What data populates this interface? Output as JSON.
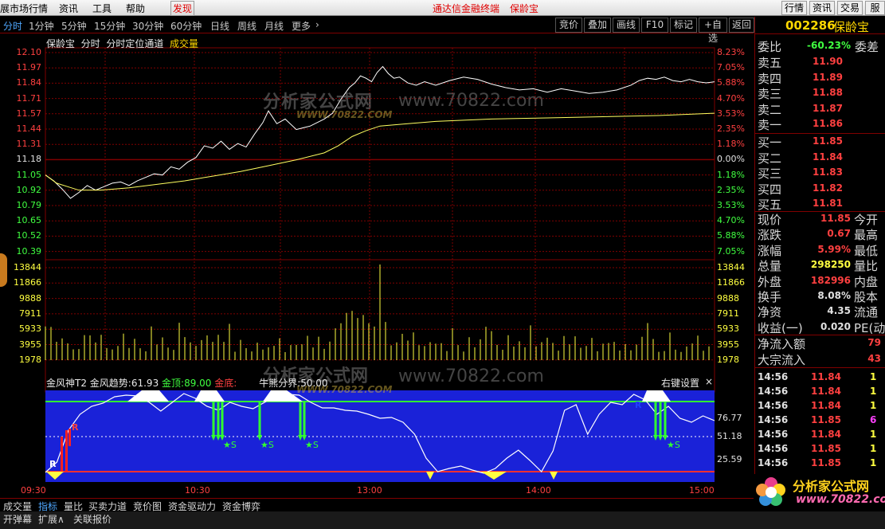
{
  "menubar": {
    "items": [
      "展市场行情",
      "资讯",
      "工具",
      "帮助"
    ],
    "discover": "发现",
    "center_app": "通达信金融终端",
    "center_stock": "保龄宝",
    "right_buttons": [
      "行情",
      "资讯",
      "交易",
      "服"
    ]
  },
  "toolbar": {
    "periods": [
      "分时",
      "1分钟",
      "5分钟",
      "15分钟",
      "30分钟",
      "60分钟",
      "日线",
      "周线",
      "月线",
      "更多"
    ],
    "more_arrow": "›",
    "buttons": [
      "竞价",
      "叠加",
      "画线",
      "F10",
      "标记",
      "+自选",
      "返回"
    ]
  },
  "chart": {
    "title_parts": [
      "保龄宝",
      "分时",
      "分时定位通道"
    ],
    "title_volume": "成交量",
    "price_ticks": [
      "12.10",
      "11.97",
      "11.84",
      "11.71",
      "11.57",
      "11.44",
      "11.31",
      "11.18",
      "11.05",
      "10.92",
      "10.79",
      "10.65",
      "10.52",
      "10.39"
    ],
    "pct_ticks": [
      "8.23%",
      "7.05%",
      "5.88%",
      "4.70%",
      "3.53%",
      "2.35%",
      "1.18%",
      "0.00%",
      "1.18%",
      "2.35%",
      "3.53%",
      "4.70%",
      "5.88%",
      "7.05%"
    ],
    "volume_ticks": [
      "13844",
      "11866",
      "9888",
      "7911",
      "5933",
      "3955",
      "1978"
    ],
    "indicator": {
      "name": "金风神T2",
      "trend_label": "金风趋势:",
      "trend_value": "61.93",
      "top_label": "金顶:",
      "top_value": "89.00",
      "bottom_label": "金底:",
      "bull_label": "牛熊分界:",
      "bull_value": "50.00",
      "settings": "右键设置",
      "close": "×",
      "y_ticks": [
        "76.77",
        "51.18",
        "25.59"
      ],
      "marks": [
        "R",
        "R",
        "R",
        "★S",
        "★S",
        "★S",
        "★S"
      ]
    },
    "time_ticks": [
      "09:30",
      "10:30",
      "13:00",
      "14:00",
      "15:00"
    ],
    "watermark_cn": "分析家公式网",
    "watermark_url": "www.70822.com",
    "watermark_url_small": "WWW.70822.COM"
  },
  "quote": {
    "code": "002286",
    "name": "保龄宝",
    "webi_label": "委比",
    "webi_value": "-60.23%",
    "weicha_label": "委差",
    "sells": [
      {
        "label": "卖五",
        "price": "11.90"
      },
      {
        "label": "卖四",
        "price": "11.89"
      },
      {
        "label": "卖三",
        "price": "11.88"
      },
      {
        "label": "卖二",
        "price": "11.87"
      },
      {
        "label": "卖一",
        "price": "11.86"
      }
    ],
    "buys": [
      {
        "label": "买一",
        "price": "11.85"
      },
      {
        "label": "买二",
        "price": "11.84"
      },
      {
        "label": "买三",
        "price": "11.83"
      },
      {
        "label": "买四",
        "price": "11.82"
      },
      {
        "label": "买五",
        "price": "11.81"
      }
    ],
    "stats": [
      {
        "label": "现价",
        "value": "11.85",
        "label2": "今开",
        "color": "#ff4040"
      },
      {
        "label": "涨跌",
        "value": "0.67",
        "label2": "最高",
        "color": "#ff4040"
      },
      {
        "label": "涨幅",
        "value": "5.99%",
        "label2": "最低",
        "color": "#ff4040"
      },
      {
        "label": "总量",
        "value": "298250",
        "label2": "量比",
        "color": "#ffff40"
      },
      {
        "label": "外盘",
        "value": "182996",
        "label2": "内盘",
        "color": "#ff4040"
      },
      {
        "label": "换手",
        "value": "8.08%",
        "label2": "股本",
        "color": "#e0e0e0"
      },
      {
        "label": "净资",
        "value": "4.35",
        "label2": "流通",
        "color": "#e0e0e0"
      },
      {
        "label": "收益(一)",
        "value": "0.020",
        "label2": "PE(动",
        "color": "#e0e0e0"
      }
    ],
    "netflow_label": "净流入额",
    "netflow_value": "79",
    "bigflow_label": "大宗流入",
    "bigflow_value": "43",
    "ticks": [
      {
        "time": "14:56",
        "price": "11.84",
        "vol": "1"
      },
      {
        "time": "14:56",
        "price": "11.84",
        "vol": "1"
      },
      {
        "time": "14:56",
        "price": "11.84",
        "vol": "1"
      },
      {
        "time": "14:56",
        "price": "11.85",
        "vol": "6"
      },
      {
        "time": "14:56",
        "price": "11.84",
        "vol": "1"
      },
      {
        "time": "14:56",
        "price": "11.85",
        "vol": "1"
      },
      {
        "time": "14:56",
        "price": "11.85",
        "vol": "1"
      }
    ],
    "logo_cn": "分析家公式网",
    "logo_url": "www.70822.com"
  },
  "bottom_tabs": [
    "成交量",
    "指标",
    "量比",
    "买卖力道",
    "竞价图",
    "资金驱动力",
    "资金博弈"
  ],
  "bottom_tabs2": [
    "开弹幕",
    "扩展∧",
    "关联报价"
  ],
  "colors": {
    "price_line": "#ffffff",
    "avg_line": "#ffff60",
    "up": "#ff4040",
    "down": "#40ff40",
    "grid": "#800000",
    "indicator_bg": "#1a22d8"
  }
}
